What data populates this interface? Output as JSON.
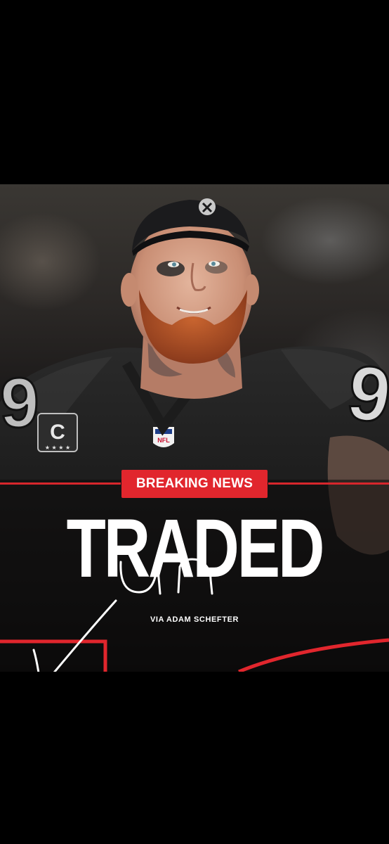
{
  "badge": {
    "label": "BREAKING NEWS"
  },
  "headline": {
    "text": "TRADED"
  },
  "credit": {
    "text": "VIA ADAM SCHEFTER"
  },
  "annotation": {
    "handwritten": "un"
  },
  "jersey": {
    "number": "9",
    "captain_patch": "C",
    "league_logo": "NFL"
  },
  "colors": {
    "accent": "#e1262d",
    "background": "#000000",
    "jersey": "#141414",
    "beard": "#b8552a"
  }
}
